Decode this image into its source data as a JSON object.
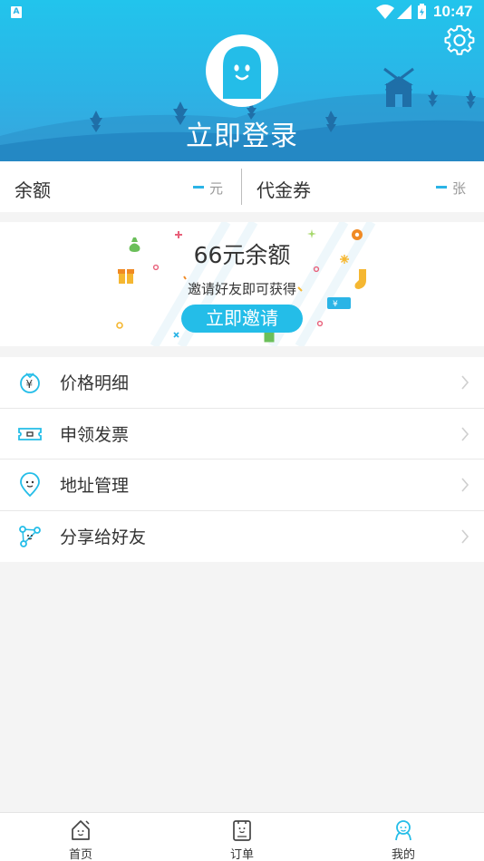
{
  "status_bar": {
    "time": "10:47",
    "app_badge": "A"
  },
  "header": {
    "login_label": "立即登录",
    "avatar_icon": "ghost-avatar-icon",
    "settings_icon": "gear-icon"
  },
  "balance": {
    "balance_label": "余额",
    "balance_value": "–",
    "balance_unit": "元",
    "voucher_label": "代金券",
    "voucher_value": "–",
    "voucher_unit": "张"
  },
  "invite": {
    "title": "66元余额",
    "subtitle": "邀请好友即可获得",
    "button_label": "立即邀请"
  },
  "menu": {
    "items": [
      {
        "label": "价格明细",
        "icon": "price-tag-icon"
      },
      {
        "label": "申领发票",
        "icon": "invoice-ticket-icon"
      },
      {
        "label": "地址管理",
        "icon": "location-pin-icon"
      },
      {
        "label": "分享给好友",
        "icon": "share-nodes-icon"
      }
    ]
  },
  "tabbar": {
    "tabs": [
      {
        "label": "首页",
        "icon": "home-icon"
      },
      {
        "label": "订单",
        "icon": "order-icon"
      },
      {
        "label": "我的",
        "icon": "profile-icon"
      }
    ],
    "active_tab": "我的"
  },
  "colors": {
    "accent": "#24bde8",
    "header_top": "#22c4ec",
    "header_bottom": "#3aa3dc"
  }
}
